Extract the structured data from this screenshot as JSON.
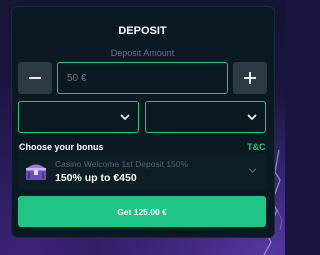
{
  "deposit": {
    "title": "DEPOSIT",
    "amount_label": "Deposit Amount",
    "amount_placeholder": "50 €",
    "minus_icon": "minus-icon",
    "plus_icon": "plus-icon",
    "selects": [
      {
        "value": "",
        "icon": "chevron-down-icon"
      },
      {
        "value": "",
        "icon": "chevron-down-icon"
      }
    ]
  },
  "bonus": {
    "heading": "Choose your bonus",
    "tc_label": "T&C",
    "selected_name": "Casino Welcome 1st Deposit 150%",
    "selected_offer": "150% up to €450",
    "icon": "treasure-chest-icon"
  },
  "submit": {
    "label": "Get 125.00 €"
  },
  "colors": {
    "accent": "#1fc584",
    "panel": "#0b1a22",
    "stepper": "#2b3a44",
    "muted_label": "#6a6ca3"
  }
}
